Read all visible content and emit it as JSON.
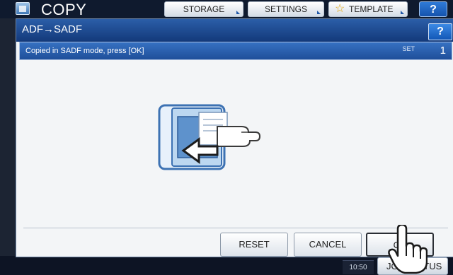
{
  "app": {
    "title": "COPY"
  },
  "top_tabs": {
    "storage": "STORAGE",
    "settings": "SETTINGS",
    "template": "TEMPLATE",
    "help": "?"
  },
  "dialog": {
    "title": "ADF→SADF",
    "help": "?",
    "message": "Copied in SADF mode, press [OK]",
    "set_label": "SET",
    "set_count": "1",
    "buttons": {
      "reset": "RESET",
      "cancel": "CANCEL",
      "ok": "OK"
    }
  },
  "status": {
    "clock": "10:50",
    "job_button": "JOB STATUS"
  },
  "colors": {
    "accent": "#1f4f9a",
    "title_bar": "#13397a",
    "help": "#1257b6"
  },
  "icons": [
    "copy-app-icon",
    "star-icon",
    "adf-to-sadf-illustration",
    "hand-pointer-cursor"
  ]
}
